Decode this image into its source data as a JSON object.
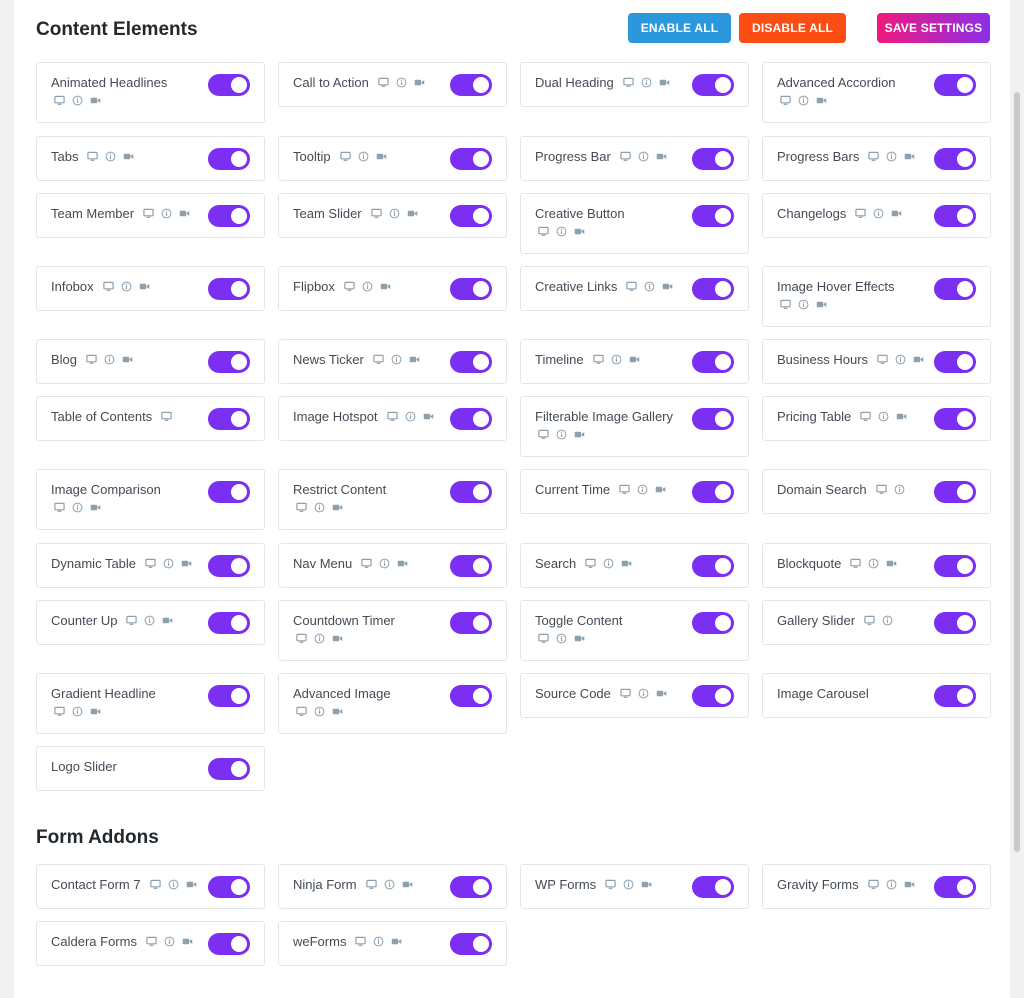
{
  "header": {
    "title": "Content Elements",
    "enable_all": "ENABLE ALL",
    "disable_all": "DISABLE ALL",
    "save_settings": "SAVE SETTINGS"
  },
  "colors": {
    "toggle_on": "#7b2ff2",
    "enable_all_bg": "#2b97dd",
    "disable_all_bg": "#fc4d14",
    "save_gradient": [
      "#f0197d",
      "#8d2fe8"
    ]
  },
  "content_elements": [
    {
      "label": "Animated Headlines",
      "icons": [
        "desktop-icon",
        "info-icon",
        "video-icon"
      ],
      "enabled": true
    },
    {
      "label": "Call to Action",
      "icons": [
        "desktop-icon",
        "info-icon",
        "video-icon"
      ],
      "enabled": true
    },
    {
      "label": "Dual Heading",
      "icons": [
        "desktop-icon",
        "info-icon",
        "video-icon"
      ],
      "enabled": true
    },
    {
      "label": "Advanced Accordion",
      "icons": [
        "desktop-icon",
        "info-icon",
        "video-icon"
      ],
      "enabled": true
    },
    {
      "label": "Tabs",
      "icons": [
        "desktop-icon",
        "info-icon",
        "video-icon"
      ],
      "enabled": true
    },
    {
      "label": "Tooltip",
      "icons": [
        "desktop-icon",
        "info-icon",
        "video-icon"
      ],
      "enabled": true
    },
    {
      "label": "Progress Bar",
      "icons": [
        "desktop-icon",
        "info-icon",
        "video-icon"
      ],
      "enabled": true
    },
    {
      "label": "Progress Bars",
      "icons": [
        "desktop-icon",
        "info-icon",
        "video-icon"
      ],
      "enabled": true
    },
    {
      "label": "Team Member",
      "icons": [
        "desktop-icon",
        "info-icon",
        "video-icon"
      ],
      "enabled": true
    },
    {
      "label": "Team Slider",
      "icons": [
        "desktop-icon",
        "info-icon",
        "video-icon"
      ],
      "enabled": true
    },
    {
      "label": "Creative Button",
      "icons": [
        "desktop-icon",
        "info-icon",
        "video-icon"
      ],
      "enabled": true
    },
    {
      "label": "Changelogs",
      "icons": [
        "desktop-icon",
        "info-icon",
        "video-icon"
      ],
      "enabled": true
    },
    {
      "label": "Infobox",
      "icons": [
        "desktop-icon",
        "info-icon",
        "video-icon"
      ],
      "enabled": true
    },
    {
      "label": "Flipbox",
      "icons": [
        "desktop-icon",
        "info-icon",
        "video-icon"
      ],
      "enabled": true
    },
    {
      "label": "Creative Links",
      "icons": [
        "desktop-icon",
        "info-icon",
        "video-icon"
      ],
      "enabled": true
    },
    {
      "label": "Image Hover Effects",
      "icons": [
        "desktop-icon",
        "info-icon",
        "video-icon"
      ],
      "enabled": true
    },
    {
      "label": "Blog",
      "icons": [
        "desktop-icon",
        "info-icon",
        "video-icon"
      ],
      "enabled": true
    },
    {
      "label": "News Ticker",
      "icons": [
        "desktop-icon",
        "info-icon",
        "video-icon"
      ],
      "enabled": true
    },
    {
      "label": "Timeline",
      "icons": [
        "desktop-icon",
        "info-icon",
        "video-icon"
      ],
      "enabled": true
    },
    {
      "label": "Business Hours",
      "icons": [
        "desktop-icon",
        "info-icon",
        "video-icon"
      ],
      "enabled": true
    },
    {
      "label": "Table of Contents",
      "icons": [
        "desktop-icon"
      ],
      "enabled": true
    },
    {
      "label": "Image Hotspot",
      "icons": [
        "desktop-icon",
        "info-icon",
        "video-icon"
      ],
      "enabled": true
    },
    {
      "label": "Filterable Image Gallery",
      "icons": [
        "desktop-icon",
        "info-icon",
        "video-icon"
      ],
      "enabled": true
    },
    {
      "label": "Pricing Table",
      "icons": [
        "desktop-icon",
        "info-icon",
        "video-icon"
      ],
      "enabled": true
    },
    {
      "label": "Image Comparison",
      "icons": [
        "desktop-icon",
        "info-icon",
        "video-icon"
      ],
      "enabled": true
    },
    {
      "label": "Restrict Content",
      "icons": [
        "desktop-icon",
        "info-icon",
        "video-icon"
      ],
      "enabled": true
    },
    {
      "label": "Current Time",
      "icons": [
        "desktop-icon",
        "info-icon",
        "video-icon"
      ],
      "enabled": true
    },
    {
      "label": "Domain Search",
      "icons": [
        "desktop-icon",
        "info-icon"
      ],
      "enabled": true
    },
    {
      "label": "Dynamic Table",
      "icons": [
        "desktop-icon",
        "info-icon",
        "video-icon"
      ],
      "enabled": true
    },
    {
      "label": "Nav Menu",
      "icons": [
        "desktop-icon",
        "info-icon",
        "video-icon"
      ],
      "enabled": true
    },
    {
      "label": "Search",
      "icons": [
        "desktop-icon",
        "info-icon",
        "video-icon"
      ],
      "enabled": true
    },
    {
      "label": "Blockquote",
      "icons": [
        "desktop-icon",
        "info-icon",
        "video-icon"
      ],
      "enabled": true
    },
    {
      "label": "Counter Up",
      "icons": [
        "desktop-icon",
        "info-icon",
        "video-icon"
      ],
      "enabled": true
    },
    {
      "label": "Countdown Timer",
      "icons": [
        "desktop-icon",
        "info-icon",
        "video-icon"
      ],
      "enabled": true
    },
    {
      "label": "Toggle Content",
      "icons": [
        "desktop-icon",
        "info-icon",
        "video-icon"
      ],
      "enabled": true
    },
    {
      "label": "Gallery Slider",
      "icons": [
        "desktop-icon",
        "info-icon"
      ],
      "enabled": true
    },
    {
      "label": "Gradient Headline",
      "icons": [
        "desktop-icon",
        "info-icon",
        "video-icon"
      ],
      "enabled": true
    },
    {
      "label": "Advanced Image",
      "icons": [
        "desktop-icon",
        "info-icon",
        "video-icon"
      ],
      "enabled": true
    },
    {
      "label": "Source Code",
      "icons": [
        "desktop-icon",
        "info-icon",
        "video-icon"
      ],
      "enabled": true
    },
    {
      "label": "Image Carousel",
      "icons": [],
      "enabled": true
    },
    {
      "label": "Logo Slider",
      "icons": [],
      "enabled": true
    }
  ],
  "form_section": {
    "title": "Form Addons",
    "items": [
      {
        "label": "Contact Form 7",
        "icons": [
          "desktop-icon",
          "info-icon",
          "video-icon"
        ],
        "enabled": true
      },
      {
        "label": "Ninja Form",
        "icons": [
          "desktop-icon",
          "info-icon",
          "video-icon"
        ],
        "enabled": true
      },
      {
        "label": "WP Forms",
        "icons": [
          "desktop-icon",
          "info-icon",
          "video-icon"
        ],
        "enabled": true
      },
      {
        "label": "Gravity Forms",
        "icons": [
          "desktop-icon",
          "info-icon",
          "video-icon"
        ],
        "enabled": true
      },
      {
        "label": "Caldera Forms",
        "icons": [
          "desktop-icon",
          "info-icon",
          "video-icon"
        ],
        "enabled": true
      },
      {
        "label": "weForms",
        "icons": [
          "desktop-icon",
          "info-icon",
          "video-icon"
        ],
        "enabled": true
      }
    ]
  }
}
